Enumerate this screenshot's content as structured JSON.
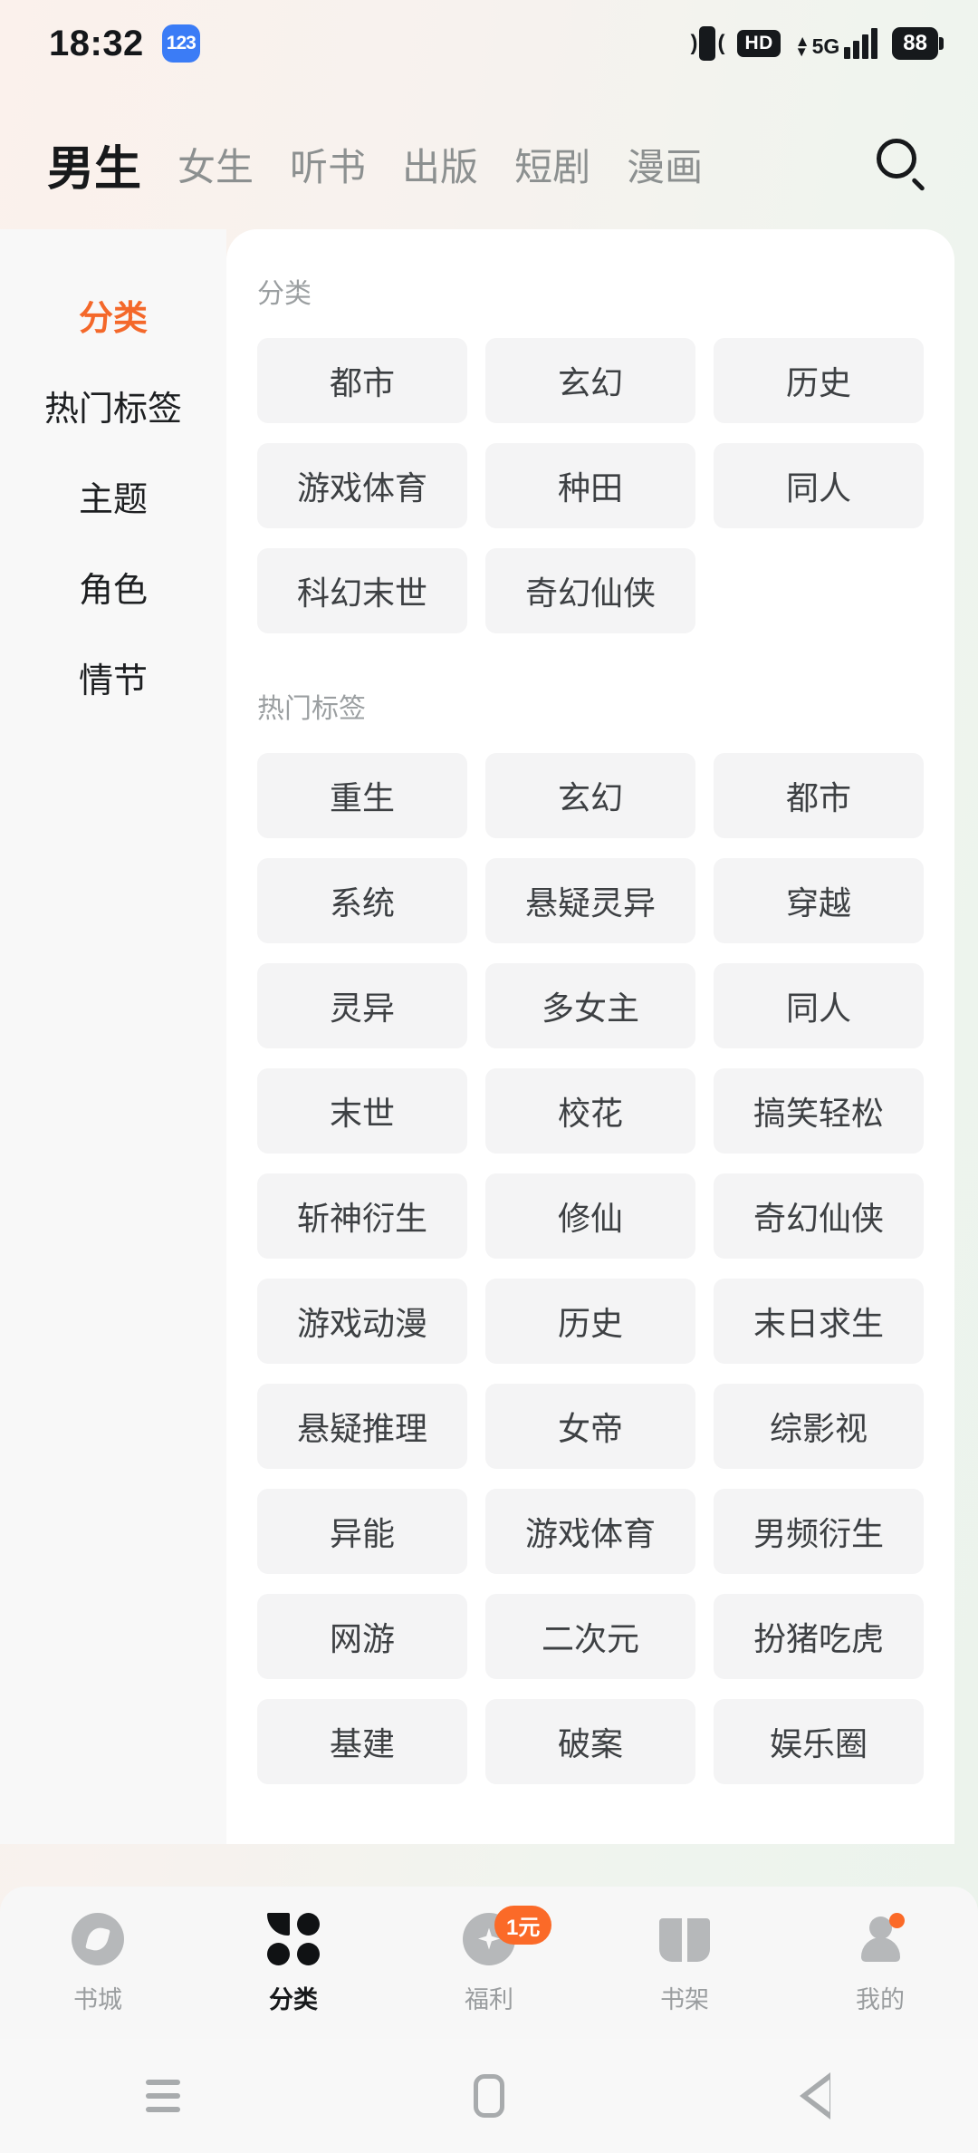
{
  "status_bar": {
    "time": "18:32",
    "app_badge": "123",
    "vibrate_icon": "vibrate-icon",
    "hd_label": "HD",
    "network_label": "5G",
    "battery_level": "88"
  },
  "top_nav": {
    "tabs": [
      {
        "label": "男生",
        "active": true
      },
      {
        "label": "女生",
        "active": false
      },
      {
        "label": "听书",
        "active": false
      },
      {
        "label": "出版",
        "active": false
      },
      {
        "label": "短剧",
        "active": false
      },
      {
        "label": "漫画",
        "active": false
      }
    ],
    "search_icon": "search-icon"
  },
  "sidebar": {
    "items": [
      {
        "label": "分类",
        "active": true
      },
      {
        "label": "热门标签",
        "active": false
      },
      {
        "label": "主题",
        "active": false
      },
      {
        "label": "角色",
        "active": false
      },
      {
        "label": "情节",
        "active": false
      }
    ]
  },
  "main": {
    "sections": [
      {
        "title": "分类",
        "tags": [
          "都市",
          "玄幻",
          "历史",
          "游戏体育",
          "种田",
          "同人",
          "科幻末世",
          "奇幻仙侠"
        ]
      },
      {
        "title": "热门标签",
        "tags": [
          "重生",
          "玄幻",
          "都市",
          "系统",
          "悬疑灵异",
          "穿越",
          "灵异",
          "多女主",
          "同人",
          "末世",
          "校花",
          "搞笑轻松",
          "斩神衍生",
          "修仙",
          "奇幻仙侠",
          "游戏动漫",
          "历史",
          "末日求生",
          "悬疑推理",
          "女帝",
          "综影视",
          "异能",
          "游戏体育",
          "男频衍生",
          "网游",
          "二次元",
          "扮猪吃虎",
          "基建",
          "破案",
          "娱乐圈"
        ]
      }
    ]
  },
  "tab_bar": {
    "items": [
      {
        "label": "书城",
        "icon": "compass-icon",
        "active": false,
        "badge": "",
        "dot": false
      },
      {
        "label": "分类",
        "icon": "grid-icon",
        "active": true,
        "badge": "",
        "dot": false
      },
      {
        "label": "福利",
        "icon": "gift-icon",
        "active": false,
        "badge": "1元",
        "dot": false
      },
      {
        "label": "书架",
        "icon": "book-icon",
        "active": false,
        "badge": "",
        "dot": false
      },
      {
        "label": "我的",
        "icon": "user-icon",
        "active": false,
        "badge": "",
        "dot": true
      }
    ]
  },
  "system_nav": {
    "recents": "recents-icon",
    "home": "home-icon",
    "back": "back-icon"
  },
  "colors": {
    "accent": "#F4682A",
    "badge": "#FB6A28",
    "chip_bg": "#F4F4F5",
    "text_dark": "#17191B",
    "text_muted": "#9A9D9F"
  }
}
